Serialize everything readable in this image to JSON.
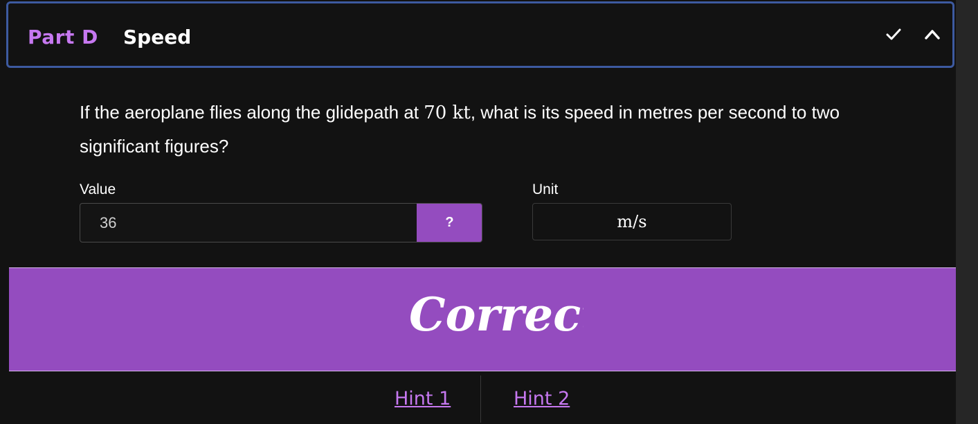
{
  "header": {
    "part": "Part D",
    "title": "Speed",
    "check_icon": "check-icon",
    "collapse_icon": "chevron-up-icon"
  },
  "question": {
    "text_before": "If the aeroplane flies along the glidepath at ",
    "math": "70 kt",
    "text_after": ", what is its speed in metres per second to two significant figures?"
  },
  "value": {
    "label": "Value",
    "input_value": "36",
    "help_label": "?"
  },
  "unit": {
    "label": "Unit",
    "value": "m/s"
  },
  "feedback": {
    "text": "Correct!",
    "color": "#944cbf"
  },
  "hints": [
    {
      "label": "Hint 1"
    },
    {
      "label": "Hint 2"
    }
  ],
  "colors": {
    "accent": "#c678f0",
    "banner": "#944cbf",
    "header_border": "#3d5aa0",
    "background": "#121212"
  }
}
